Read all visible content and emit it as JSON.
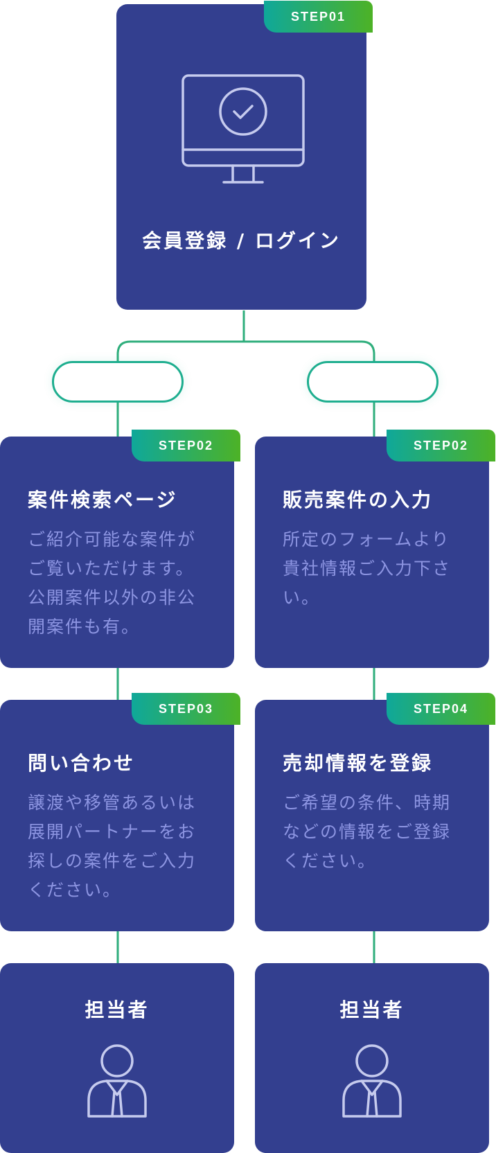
{
  "colors": {
    "card": "#333f8f",
    "accent_start": "#0fa89a",
    "accent_end": "#4db226",
    "desc_text": "#8d95e2",
    "icon_line": "#c6cbee"
  },
  "step1": {
    "tag": "STEP01",
    "title": "会員登録 / ログイン",
    "icon": "computer-monitor-check-icon"
  },
  "left_branch": {
    "pill_label": "",
    "step_a": {
      "tag": "STEP02",
      "title": "案件検索ページ",
      "desc": [
        "ご紹介可能な案件が",
        "ご覧いただけます。",
        "公開案件以外の非公",
        "開案件も有。"
      ]
    },
    "step_b": {
      "tag": "STEP03",
      "title": "問い合わせ",
      "desc": [
        "譲渡や移管あるいは",
        "展開パートナーをお",
        "探しの案件をご入力",
        "ください。"
      ]
    },
    "contact": {
      "title": "担当者",
      "icon": "person-icon"
    }
  },
  "right_branch": {
    "pill_label": "",
    "step_a": {
      "tag": "STEP02",
      "title": "販売案件の入力",
      "desc": [
        "所定のフォームより",
        "貴社情報ご入力下さ",
        "い。"
      ]
    },
    "step_b": {
      "tag": "STEP04",
      "title": "売却情報を登録",
      "desc": [
        "ご希望の条件、時期",
        "などの情報をご登録",
        "ください。"
      ]
    },
    "contact": {
      "title": "担当者",
      "icon": "person-icon"
    }
  }
}
